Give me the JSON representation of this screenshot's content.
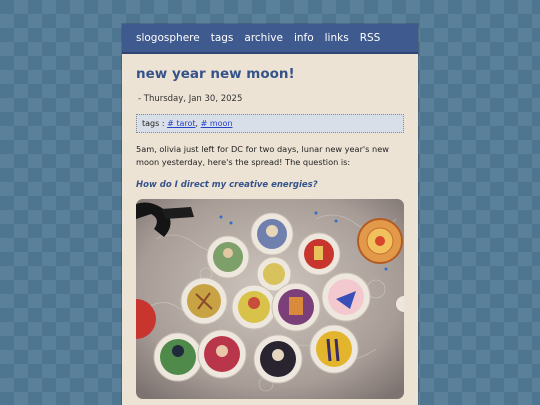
{
  "nav": {
    "site_name": "slogosphere",
    "links": [
      "tags",
      "archive",
      "info",
      "links",
      "RSS"
    ]
  },
  "post": {
    "title": "new year new moon!",
    "date": "- Thursday, Jan 30, 2025",
    "tags_label": "tags :",
    "tags": [
      "# tarot",
      "# moon"
    ],
    "tag_separator": ",",
    "body": "5am, olivia just left for DC for two days, lunar new year's new moon yesterday, here's the spread! The question is:",
    "question": "How do I direct my creative energies?",
    "photo_icon": "tarot-spread-photo"
  },
  "colors": {
    "background": "#4f7691",
    "navbar": "#3f5a8e",
    "page": "#ede3d4",
    "title": "#35538a",
    "tag_box": "#d9dfe8",
    "link": "#2443c9"
  }
}
